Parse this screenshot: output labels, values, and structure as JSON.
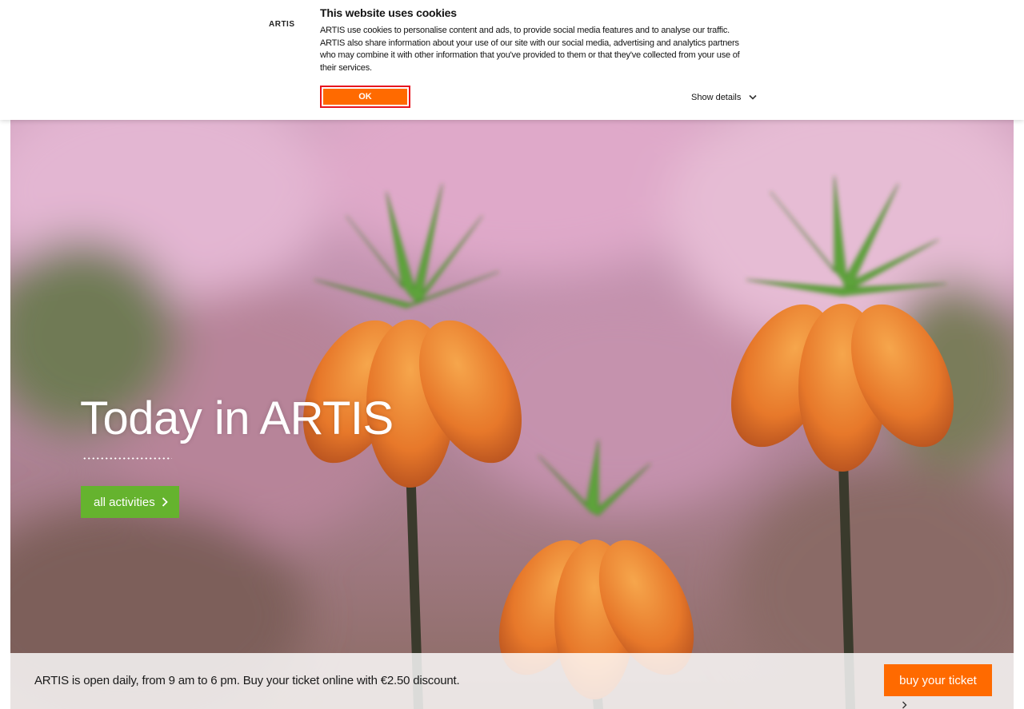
{
  "cookie_banner": {
    "logo": "ARTIS",
    "title": "This website uses cookies",
    "body": "ARTIS use cookies to personalise content and ads, to provide social media features and to analyse our traffic. ARTIS also share information about your use of our site with our social media, advertising and analytics partners who may combine it with other information that you've provided to them or that they've collected from your use of their services.",
    "ok_label": "OK",
    "details_label": "Show details",
    "details_icon": "chevron-down-icon"
  },
  "hero": {
    "title": "Today in ARTIS",
    "button_label": "all activities",
    "button_icon": "chevron-right-icon"
  },
  "info_bar": {
    "text": "ARTIS is open daily, from 9 am to 6 pm. Buy your ticket online with €2.50 discount.",
    "ticket_label": "buy your ticket"
  },
  "colors": {
    "accent_orange": "#ff6a00",
    "ok_border_red": "#e8141e",
    "button_green": "#65b32e"
  }
}
